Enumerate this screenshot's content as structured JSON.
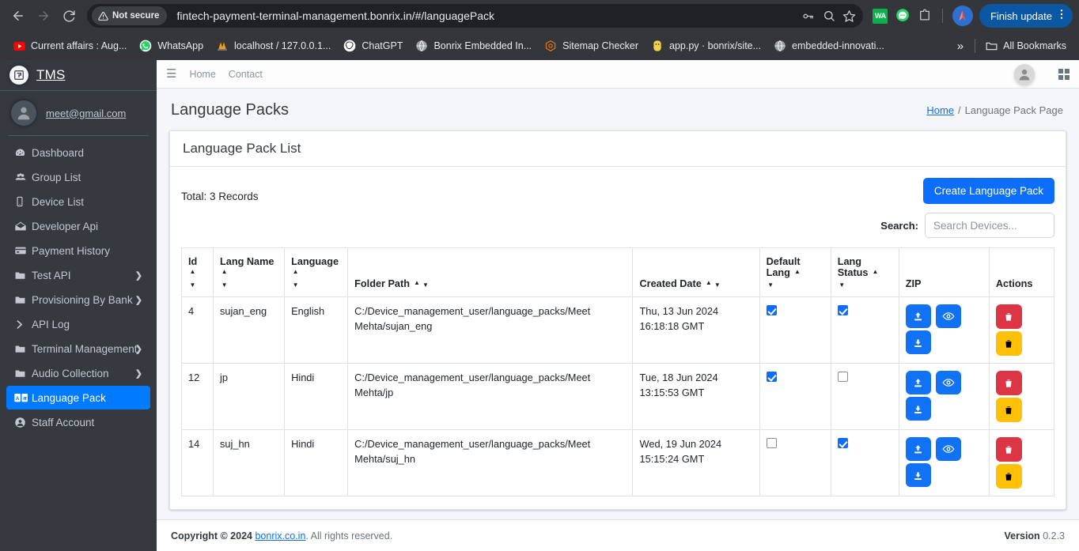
{
  "browser": {
    "back_icon": "back-arrow-icon",
    "forward_icon": "forward-arrow-icon",
    "reload_icon": "reload-icon",
    "security_label": "Not secure",
    "url": "fintech-payment-terminal-management.bonrix.in/#/languagePack",
    "omnibox_icons": [
      "password-key-icon",
      "search-icon",
      "bookmark-star-icon"
    ],
    "extensions": [
      "wa-extension-icon",
      "whatsapp-extension-icon",
      "extensions-puzzle-icon"
    ],
    "wa_badge": "WA",
    "finish_update_label": "Finish update",
    "bookmarks": [
      {
        "label": "Current affairs : Aug...",
        "icon": "youtube-icon"
      },
      {
        "label": "WhatsApp",
        "icon": "whatsapp-icon"
      },
      {
        "label": "localhost / 127.0.0.1...",
        "icon": "phpmyadmin-icon"
      },
      {
        "label": "ChatGPT",
        "icon": "chatgpt-icon"
      },
      {
        "label": "Bonrix Embedded In...",
        "icon": "globe-icon"
      },
      {
        "label": "Sitemap Checker",
        "icon": "hexagon-icon"
      },
      {
        "label": "app.py · bonrix/site...",
        "icon": "python-icon"
      },
      {
        "label": "embedded-innovati...",
        "icon": "globe-icon"
      }
    ],
    "overflow_label": "»",
    "all_bookmarks_label": "All Bookmarks"
  },
  "sidebar": {
    "brand": "TMS",
    "brand_logo": "tms-logo-icon",
    "user_email": "meet@gmail.com",
    "items": [
      {
        "label": "Dashboard",
        "icon": "dashboard-icon",
        "arrow": "",
        "active": false
      },
      {
        "label": "Group List",
        "icon": "group-icon",
        "arrow": "",
        "active": false
      },
      {
        "label": "Device List",
        "icon": "device-icon",
        "arrow": "",
        "active": false
      },
      {
        "label": "Developer Api",
        "icon": "envelope-icon",
        "arrow": "",
        "active": false
      },
      {
        "label": "Payment History",
        "icon": "credit-card-icon",
        "arrow": "",
        "active": false
      },
      {
        "label": "Test API",
        "icon": "folder-icon",
        "arrow": "❯",
        "active": false
      },
      {
        "label": "Provisioning By Bank",
        "icon": "folder-icon",
        "arrow": "❯",
        "active": false
      },
      {
        "label": "API Log",
        "icon": "chevron-right-icon",
        "arrow": "",
        "active": false
      },
      {
        "label": "Terminal Management",
        "icon": "folder-icon",
        "arrow": "❯",
        "active": false
      },
      {
        "label": "Audio Collection",
        "icon": "folder-icon",
        "arrow": "❯",
        "active": false
      },
      {
        "label": "Language Pack",
        "icon": "language-pack-icon",
        "arrow": "",
        "active": true
      },
      {
        "label": "Staff Account",
        "icon": "user-circle-icon",
        "arrow": "",
        "active": false
      }
    ]
  },
  "topbar": {
    "menu_icon": "hamburger-icon",
    "links": [
      "Home",
      "Contact"
    ],
    "avatar_icon": "user-avatar-icon",
    "grid_icon": "grid-icon"
  },
  "page": {
    "title": "Language Packs",
    "breadcrumb_home": "Home",
    "breadcrumb_sep": "/",
    "breadcrumb_current": "Language Pack Page"
  },
  "card": {
    "title": "Language Pack List",
    "total_records": "Total: 3 Records",
    "create_label": "Create Language Pack",
    "search_label": "Search:",
    "search_placeholder": "Search Devices...",
    "search_value": ""
  },
  "table": {
    "columns": [
      {
        "label": "Id",
        "sortable": true
      },
      {
        "label": "Lang Name",
        "sortable": true
      },
      {
        "label": "Language",
        "sortable": true
      },
      {
        "label": "Folder Path",
        "sortable": true
      },
      {
        "label": "Created Date",
        "sortable": true
      },
      {
        "label": "Default Lang",
        "sortable": true
      },
      {
        "label": "Lang Status",
        "sortable": true
      },
      {
        "label": "ZIP",
        "sortable": false
      },
      {
        "label": "Actions",
        "sortable": false
      }
    ],
    "rows": [
      {
        "id": "4",
        "lang_name": "sujan_eng",
        "language": "English",
        "folder_path": "C:/Device_management_user/language_packs/Meet Mehta/sujan_eng",
        "created_date": "Thu, 13 Jun 2024 16:18:18 GMT",
        "default_lang": true,
        "lang_status": true
      },
      {
        "id": "12",
        "lang_name": "jp",
        "language": "Hindi",
        "folder_path": "C:/Device_management_user/language_packs/Meet Mehta/jp",
        "created_date": "Tue, 18 Jun 2024 13:15:53 GMT",
        "default_lang": true,
        "lang_status": false
      },
      {
        "id": "14",
        "lang_name": "suj_hn",
        "language": "Hindi",
        "folder_path": "C:/Device_management_user/language_packs/Meet Mehta/suj_hn",
        "created_date": "Wed, 19 Jun 2024 15:15:24 GMT",
        "default_lang": false,
        "lang_status": true
      }
    ],
    "row_actions": {
      "upload_icon": "upload-icon",
      "download_icon": "download-icon",
      "view_icon": "eye-icon",
      "delete_icon": "trash-red-icon",
      "archive_icon": "trash-yellow-icon"
    }
  },
  "footer": {
    "copyright_prefix": "Copyright © 2024",
    "copyright_link": "bonrix.co.in",
    "copyright_suffix": ". All rights reserved.",
    "version_label": "Version",
    "version_number": "0.2.3"
  },
  "colors": {
    "sidebar_bg": "#343a40",
    "accent": "#0d6efd",
    "danger": "#dc3545",
    "warning": "#ffc107",
    "browser_chrome": "#35363a"
  }
}
